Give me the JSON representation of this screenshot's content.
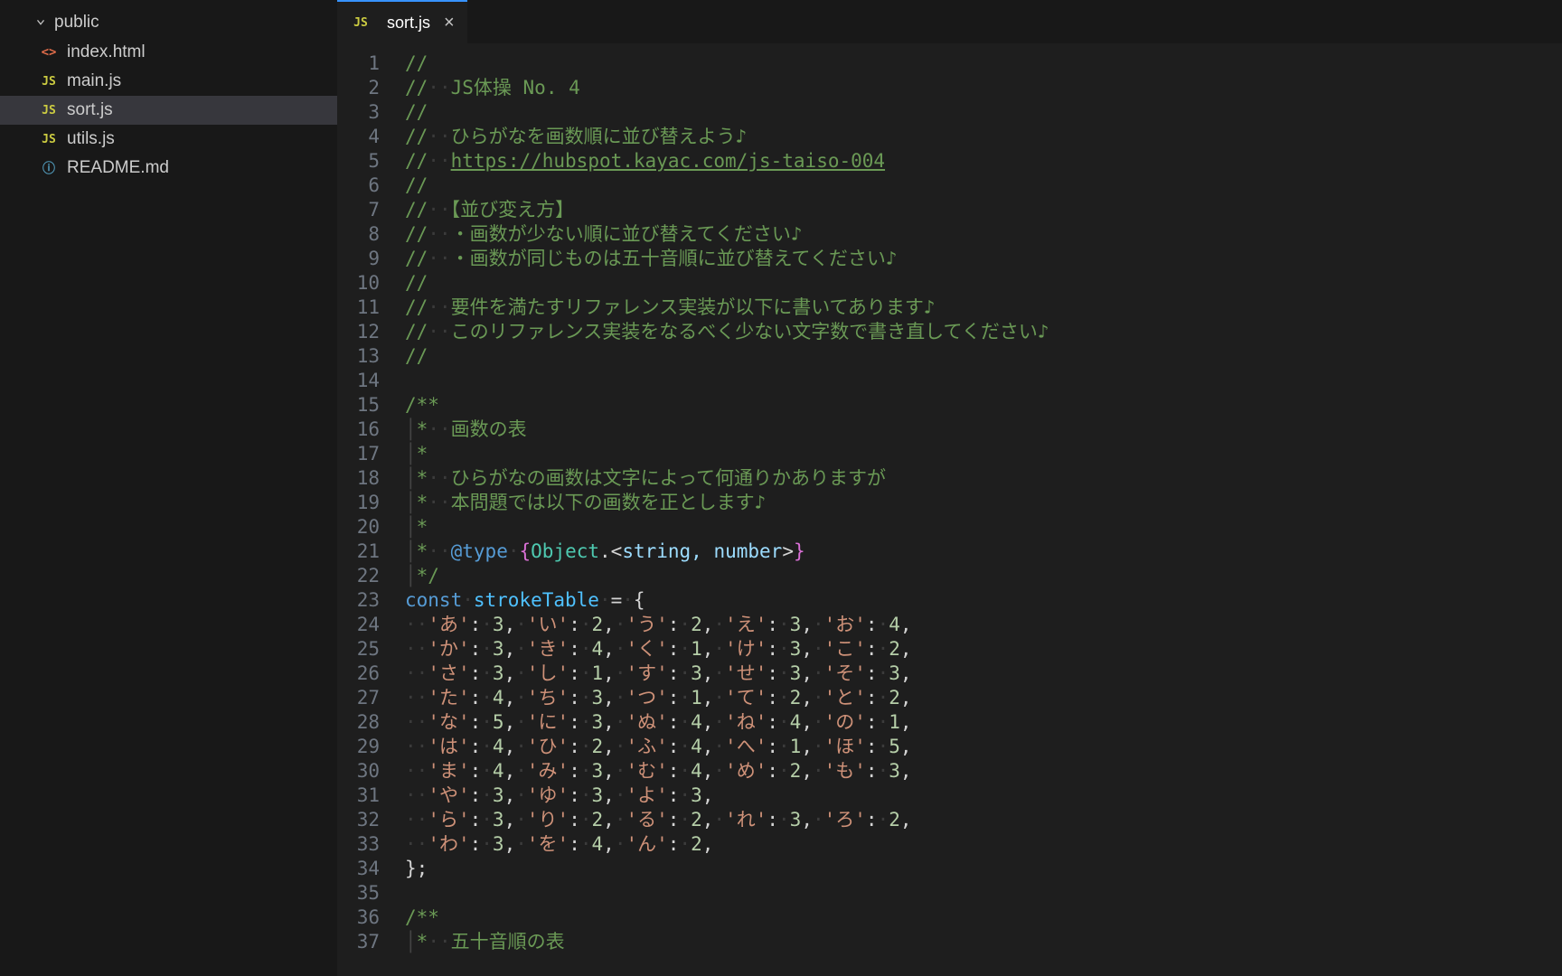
{
  "sidebar": {
    "folder": "public",
    "files": [
      {
        "name": "index.html",
        "icon": "html"
      },
      {
        "name": "main.js",
        "icon": "js"
      },
      {
        "name": "sort.js",
        "icon": "js",
        "selected": true
      },
      {
        "name": "utils.js",
        "icon": "js"
      },
      {
        "name": "README.md",
        "icon": "readme"
      }
    ]
  },
  "tab": {
    "icon": "js",
    "name": "sort.js"
  },
  "code": {
    "title": "JS体操 No. 4",
    "task": "ひらがなを画数順に並び替えよう♪",
    "url": "https://hubspot.kayac.com/js-taiso-004",
    "ruleHeading": "【並び変え方】",
    "rule1": "・画数が少ない順に並び替えてください♪",
    "rule2": "・画数が同じものは五十音順に並び替えてください♪",
    "refNote1": "要件を満たすリファレンス実装が以下に書いてあります♪",
    "refNote2": "このリファレンス実装をなるべく少ない文字数で書き直してください♪",
    "doc_strokes_title": "画数の表",
    "doc_strokes_l1": "ひらがなの画数は文字によって何通りかありますが",
    "doc_strokes_l2": "本問題では以下の画数を正とします♪",
    "atType": "@type",
    "typeExpr_obj": "Object",
    "typeExpr_args": "string, number",
    "constKw": "const",
    "varName": "strokeTable",
    "doc_50_title": "五十音順の表",
    "strokeTable": {
      "あ": 3,
      "い": 2,
      "う": 2,
      "え": 3,
      "お": 4,
      "か": 3,
      "き": 4,
      "く": 1,
      "け": 3,
      "こ": 2,
      "さ": 3,
      "し": 1,
      "す": 3,
      "せ": 3,
      "そ": 3,
      "た": 4,
      "ち": 3,
      "つ": 1,
      "て": 2,
      "と": 2,
      "な": 5,
      "に": 3,
      "ぬ": 4,
      "ね": 4,
      "の": 1,
      "は": 4,
      "ひ": 2,
      "ふ": 4,
      "へ": 1,
      "ほ": 5,
      "ま": 4,
      "み": 3,
      "む": 4,
      "め": 2,
      "も": 3,
      "や": 3,
      "ゆ": 3,
      "よ": 3,
      "ら": 3,
      "り": 2,
      "る": 2,
      "れ": 3,
      "ろ": 2,
      "わ": 3,
      "を": 4,
      "ん": 2
    },
    "tableRows": [
      [
        "あ",
        "い",
        "う",
        "え",
        "お"
      ],
      [
        "か",
        "き",
        "く",
        "け",
        "こ"
      ],
      [
        "さ",
        "し",
        "す",
        "せ",
        "そ"
      ],
      [
        "た",
        "ち",
        "つ",
        "て",
        "と"
      ],
      [
        "な",
        "に",
        "ぬ",
        "ね",
        "の"
      ],
      [
        "は",
        "ひ",
        "ふ",
        "へ",
        "ほ"
      ],
      [
        "ま",
        "み",
        "む",
        "め",
        "も"
      ],
      [
        "や",
        "ゆ",
        "よ"
      ],
      [
        "ら",
        "り",
        "る",
        "れ",
        "ろ"
      ],
      [
        "わ",
        "を",
        "ん"
      ]
    ],
    "lineCount": 37
  }
}
